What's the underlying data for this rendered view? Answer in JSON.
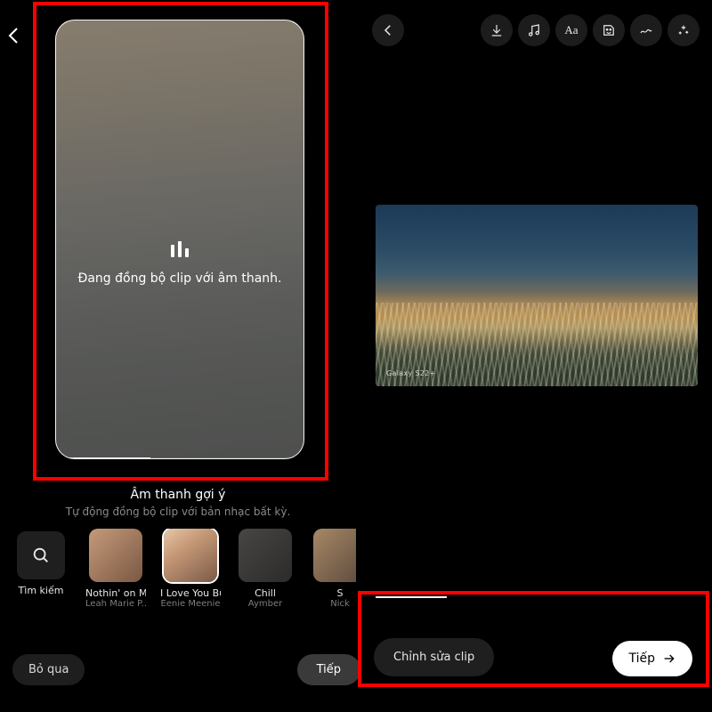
{
  "left": {
    "sync_text": "Đang đồng bộ clip với âm thanh.",
    "section_title": "Âm thanh gợi ý",
    "section_sub": "Tự động đồng bộ clip với bản nhạc bất kỳ.",
    "tracks": [
      {
        "name": "Tìm kiếm",
        "artist": ""
      },
      {
        "name": "Nothin' on Me",
        "artist": "Leah Marie P..."
      },
      {
        "name": "I Love You Bu",
        "artist": "Eenie Meenie"
      },
      {
        "name": "Chill",
        "artist": "Aymber"
      },
      {
        "name": "S",
        "artist": "Nick"
      }
    ],
    "skip_label": "Bỏ qua",
    "next_label": "Tiếp"
  },
  "right": {
    "watermark": "Galaxy S22+",
    "edit_label": "Chỉnh sửa clip",
    "next_label": "Tiếp"
  }
}
